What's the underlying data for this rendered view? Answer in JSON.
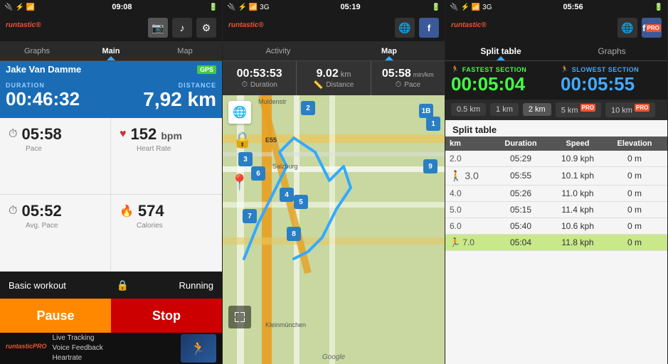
{
  "panel1": {
    "status": {
      "time": "09:08",
      "icons": "⚡📶"
    },
    "logo": "runtastic",
    "logo_sup": "®",
    "tabs": [
      "Graphs",
      "Main",
      "Map"
    ],
    "active_tab": "Main",
    "username": "Jake Van Damme",
    "gps": "GPS",
    "duration_label": "DURATION",
    "duration_value": "00:46:32",
    "distance_label": "DISTANCE",
    "distance_value": "7,92 km",
    "pace_icon": "⏱",
    "pace_value": "05:58",
    "pace_label": "Pace",
    "hr_icon": "♥",
    "hr_value": "152",
    "hr_unit": "bpm",
    "hr_label": "Heart Rate",
    "avg_pace_icon": "⏱",
    "avg_pace_value": "05:52",
    "avg_pace_label": "Avg. Pace",
    "cal_icon": "🔥",
    "cal_value": "574",
    "cal_label": "Calories",
    "workout_label": "Basic workout",
    "running_label": "Running",
    "pause_label": "Pause",
    "stop_label": "Stop",
    "promo_logo": "runtastic",
    "promo_sup": "PRO",
    "promo_text": "Live Tracking\nVoice Feedback\nHeartrate"
  },
  "panel2": {
    "status": {
      "time": "05:19",
      "icons": "📶"
    },
    "logo": "runtastic",
    "tabs": [
      "Activity",
      "Map"
    ],
    "active_tab": "Map",
    "data_items": [
      {
        "value": "00:53:53",
        "icon": "⏱",
        "label": "Duration"
      },
      {
        "value": "9.02",
        "icon": "📏",
        "label": "Distance",
        "unit": "km"
      },
      {
        "value": "05:58",
        "icon": "⏱",
        "label": "Pace",
        "unit": "min/km"
      }
    ],
    "map_numbers": [
      "1B",
      "1",
      "2",
      "3",
      "4",
      "5",
      "6",
      "7",
      "8",
      "9"
    ],
    "place_labels": [
      "Muldenstr",
      "E55",
      "Salzburg",
      "Kleinmünchen"
    ],
    "google_label": "Google"
  },
  "panel3": {
    "status": {
      "time": "05:56",
      "icons": "📶"
    },
    "logo": "runtastic",
    "logo_sup": "®",
    "tabs": [
      "Split table",
      "Graphs"
    ],
    "active_tab": "Split table",
    "fastest_label": "FASTEST SECTION",
    "fastest_icon": "🏃",
    "fastest_time": "00:05:04",
    "slowest_label": "SLOWEST SECTION",
    "slowest_icon": "🏃",
    "slowest_time": "00:05:55",
    "km_filters": [
      "0.5 km",
      "1 km",
      "2 km",
      "5 km",
      "10 km"
    ],
    "active_km": "2 km",
    "table_title": "Split table",
    "col_headers": [
      "km",
      "Duration",
      "Speed",
      "Elevation"
    ],
    "rows": [
      {
        "km": "2.0",
        "duration": "05:29",
        "speed": "10.9 kph",
        "elevation": "0 m",
        "type": "normal"
      },
      {
        "km": "3.0",
        "duration": "05:55",
        "speed": "10.1 kph",
        "elevation": "0 m",
        "type": "walk"
      },
      {
        "km": "4.0",
        "duration": "05:26",
        "speed": "11.0 kph",
        "elevation": "0 m",
        "type": "normal"
      },
      {
        "km": "5.0",
        "duration": "05:15",
        "speed": "11.4 kph",
        "elevation": "0 m",
        "type": "normal"
      },
      {
        "km": "6.0",
        "duration": "05:40",
        "speed": "10.6 kph",
        "elevation": "0 m",
        "type": "normal"
      },
      {
        "km": "7.0",
        "duration": "05:04",
        "speed": "11.8 kph",
        "elevation": "0 m",
        "type": "highlight"
      }
    ]
  }
}
